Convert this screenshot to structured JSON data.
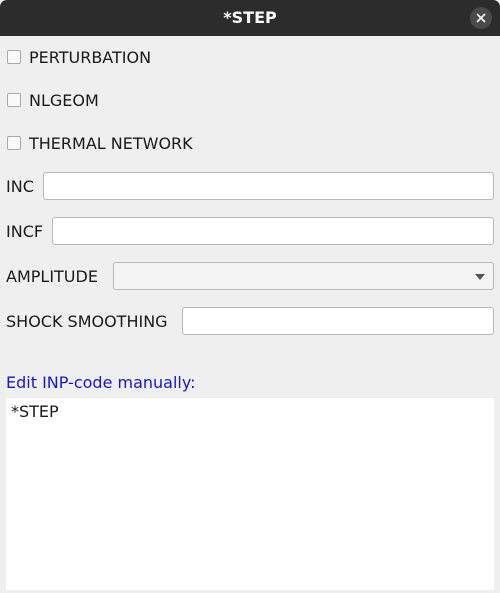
{
  "window": {
    "title": "*STEP"
  },
  "checkboxes": [
    {
      "label": "PERTURBATION",
      "checked": false
    },
    {
      "label": "NLGEOM",
      "checked": false
    },
    {
      "label": "THERMAL NETWORK",
      "checked": false
    }
  ],
  "fields": {
    "inc": {
      "label": "INC",
      "value": ""
    },
    "incf": {
      "label": "INCF",
      "value": ""
    },
    "amplitude": {
      "label": "AMPLITUDE",
      "selected": ""
    },
    "shock_smoothing": {
      "label": "SHOCK SMOOTHING",
      "value": ""
    }
  },
  "editor": {
    "label": "Edit INP-code manually:",
    "content": "*STEP"
  },
  "colors": {
    "titlebar": "#2c2c2c",
    "background": "#efefef",
    "link_label": "#1818c8"
  },
  "icons": {
    "close": "close-icon",
    "dropdown": "chevron-down-icon"
  }
}
